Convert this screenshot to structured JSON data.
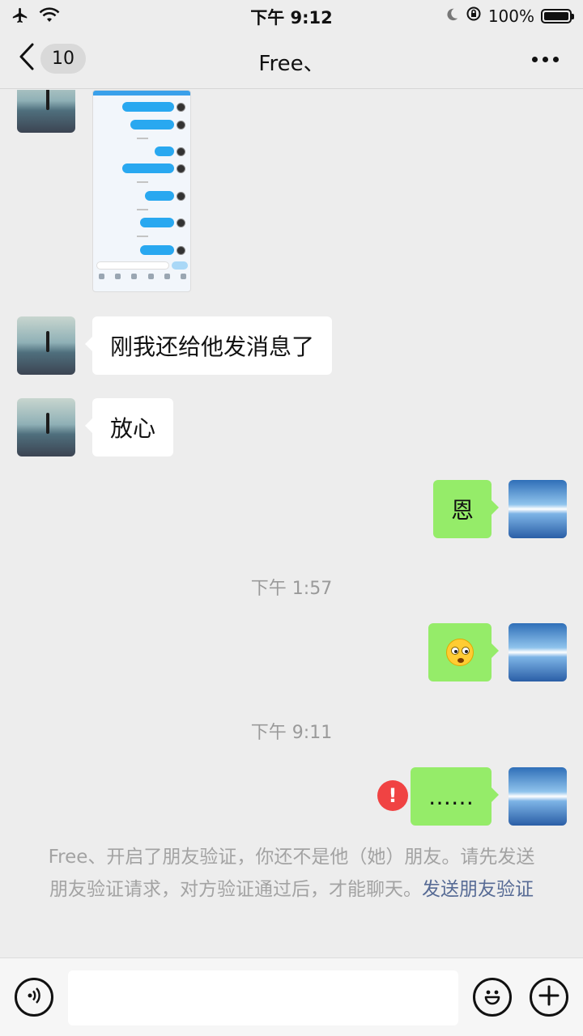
{
  "status_bar": {
    "time": "下午 9:12",
    "battery": "100%",
    "battery_level": 1.0,
    "icons": [
      "airplane-icon",
      "wifi-icon",
      "moon-icon",
      "orientation-lock-icon",
      "battery-icon"
    ]
  },
  "nav": {
    "unread_count": "10",
    "title": "Free、",
    "icons": [
      "chevron-left-icon",
      "more-icon"
    ]
  },
  "messages": [
    {
      "side": "left",
      "type": "image"
    },
    {
      "side": "left",
      "type": "text",
      "text": "刚我还给他发消息了"
    },
    {
      "side": "left",
      "type": "text",
      "text": "放心"
    },
    {
      "side": "right",
      "type": "text",
      "text": "恩"
    },
    {
      "type": "timestamp",
      "text": "下午 1:57"
    },
    {
      "side": "right",
      "type": "emoji",
      "emoji": "flushed-face"
    },
    {
      "type": "timestamp",
      "text": "下午 9:11"
    },
    {
      "side": "right",
      "type": "text",
      "text": "……",
      "failed": true,
      "error_glyph": "!"
    }
  ],
  "system_notice": {
    "text": "Free、开启了朋友验证，你还不是他（她）朋友。请先发送朋友验证请求，对方验证通过后，才能聊天。",
    "link": "发送朋友验证"
  },
  "input_bar": {
    "value": "",
    "placeholder": "",
    "icons": [
      "voice-icon",
      "emoji-icon",
      "add-icon"
    ]
  },
  "colors": {
    "background": "#ededed",
    "my_bubble": "#95ec69",
    "their_bubble": "#ffffff",
    "link": "#576b95",
    "error": "#f04343",
    "mini_bubble": "#29a8f0"
  }
}
